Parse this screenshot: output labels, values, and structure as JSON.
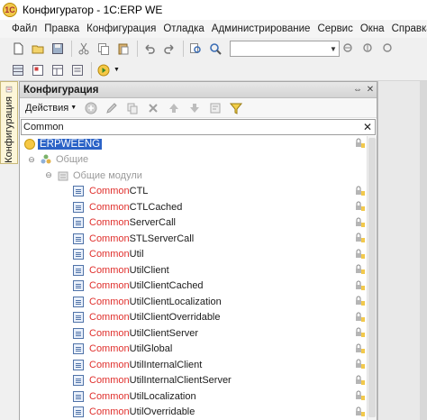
{
  "window": {
    "title": "Конфигуратор - 1C:ERP WE"
  },
  "menu": {
    "items": [
      "Файл",
      "Правка",
      "Конфигурация",
      "Отладка",
      "Администрирование",
      "Сервис",
      "Окна",
      "Справка"
    ]
  },
  "side_tab": {
    "label": "Конфигурация"
  },
  "panel": {
    "title": "Конфигурация",
    "actions_label": "Действия",
    "filter_value": "Common",
    "filter_clear": "✕"
  },
  "tree": {
    "root": "ERPWEENG",
    "common": "Общие",
    "common_modules": "Общие модули",
    "modules": [
      {
        "prefix": "Common",
        "suffix": "CTL"
      },
      {
        "prefix": "Common",
        "suffix": "CTLCached"
      },
      {
        "prefix": "Common",
        "suffix": "ServerCall"
      },
      {
        "prefix": "Common",
        "suffix": "STLServerCall"
      },
      {
        "prefix": "Common",
        "suffix": "Util"
      },
      {
        "prefix": "Common",
        "suffix": "UtilClient"
      },
      {
        "prefix": "Common",
        "suffix": "UtilClientCached"
      },
      {
        "prefix": "Common",
        "suffix": "UtilClientLocalization"
      },
      {
        "prefix": "Common",
        "suffix": "UtilClientOverridable"
      },
      {
        "prefix": "Common",
        "suffix": "UtilClientServer"
      },
      {
        "prefix": "Common",
        "suffix": "UtilGlobal"
      },
      {
        "prefix": "Common",
        "suffix": "UtilInternalClient"
      },
      {
        "prefix": "Common",
        "suffix": "UtilInternalClientServer"
      },
      {
        "prefix": "Common",
        "suffix": "UtilLocalization"
      },
      {
        "prefix": "Common",
        "suffix": "UtilOverridable"
      }
    ]
  },
  "colors": {
    "highlight_match": "#e0302d",
    "selection": "#2b63c7"
  }
}
